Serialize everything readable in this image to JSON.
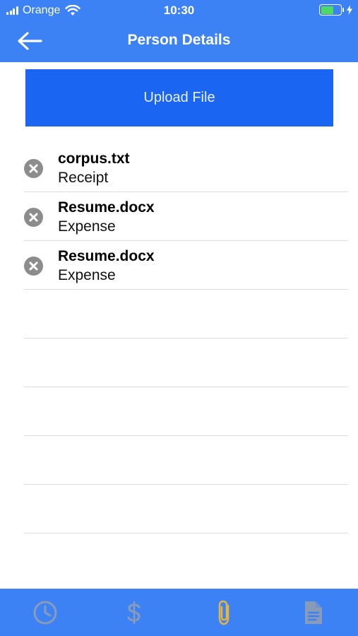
{
  "status_bar": {
    "carrier": "Orange",
    "time": "10:30",
    "battery_level": 0.65,
    "battery_color": "#4cd964"
  },
  "header": {
    "title": "Person Details",
    "back_icon": "arrow-left-icon",
    "color": "#3d82f5"
  },
  "upload_button": {
    "label": "Upload File",
    "color": "#1a66f2"
  },
  "files": [
    {
      "name": "corpus.txt",
      "type": "Receipt",
      "remove_icon": "remove-circle-icon"
    },
    {
      "name": "Resume.docx",
      "type": "Expense",
      "remove_icon": "remove-circle-icon"
    },
    {
      "name": "Resume.docx",
      "type": "Expense",
      "remove_icon": "remove-circle-icon"
    }
  ],
  "tab_bar": {
    "tabs": [
      {
        "icon": "clock-icon",
        "active": false
      },
      {
        "icon": "dollar-icon",
        "active": false
      },
      {
        "icon": "paperclip-icon",
        "active": true
      },
      {
        "icon": "document-icon",
        "active": false
      }
    ],
    "active_color": "#e8b43a",
    "inactive_color": "#8a9bb8"
  }
}
